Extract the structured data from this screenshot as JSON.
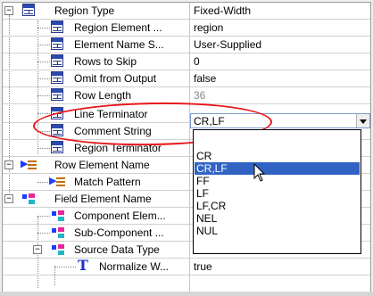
{
  "rows": [
    {
      "name": "Region Type",
      "value": "Fixed-Width"
    },
    {
      "name": "Region Element ...",
      "value": "region"
    },
    {
      "name": "Element Name S...",
      "value": "User-Supplied"
    },
    {
      "name": "Rows to Skip",
      "value": "0"
    },
    {
      "name": "Omit from Output",
      "value": "false"
    },
    {
      "name": "Row Length",
      "value": "36"
    },
    {
      "name": "Line Terminator",
      "value": "CR,LF"
    },
    {
      "name": "Comment String",
      "value": ""
    },
    {
      "name": "Region Terminator",
      "value": ""
    },
    {
      "name": "Row Element Name",
      "value": ""
    },
    {
      "name": "Match Pattern",
      "value": ""
    },
    {
      "name": "Field Element Name",
      "value": ""
    },
    {
      "name": "Component Elem...",
      "value": ""
    },
    {
      "name": "Sub-Component ...",
      "value": ""
    },
    {
      "name": "Source Data Type",
      "value": ""
    },
    {
      "name": "Normalize W...",
      "value": "true"
    }
  ],
  "editor": {
    "value": "CR,LF"
  },
  "dropdown": {
    "options": [
      "CR",
      "CR,LF",
      "FF",
      "LF",
      "LF,CR",
      "NEL",
      "NUL"
    ],
    "selected": "CR,LF"
  },
  "expanders": {
    "collapse": "−"
  },
  "icons": {
    "table": "table-property-icon",
    "row_element": "row-element-icon",
    "field_element": "field-element-icon",
    "text": "text-type-icon",
    "cursor": "arrow-cursor-icon"
  },
  "colors": {
    "selection": "#3163c5",
    "highlight": "#e8171c"
  }
}
